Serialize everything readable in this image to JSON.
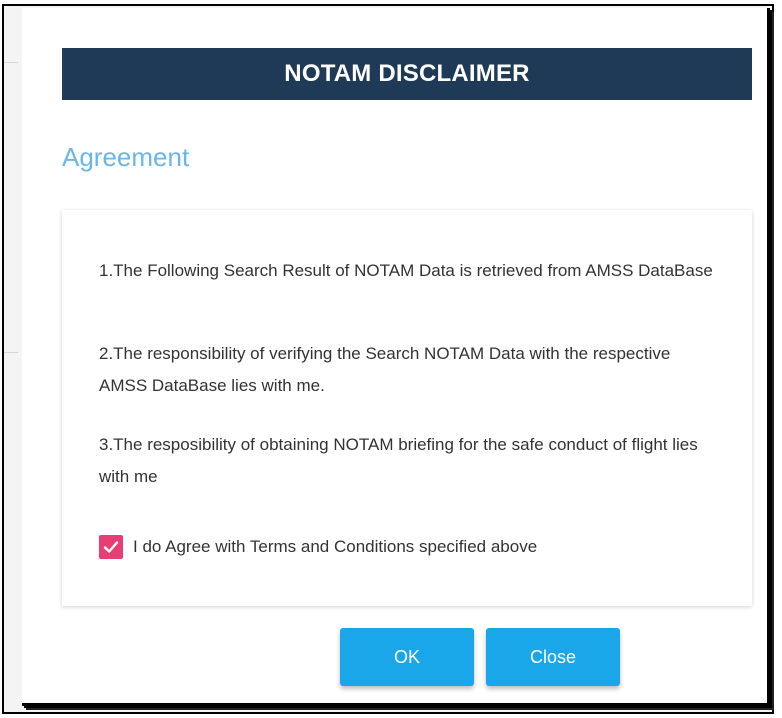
{
  "dialog": {
    "title": "NOTAM DISCLAIMER",
    "section_heading": "Agreement",
    "clauses": [
      "1.The Following Search Result of NOTAM Data is retrieved from AMSS DataBase",
      "2.The responsibility of verifying the Search NOTAM Data with the respective AMSS DataBase lies with me.",
      "3.The resposibility of obtaining NOTAM briefing for the safe conduct of flight lies with me"
    ],
    "agree_checkbox": {
      "checked": true,
      "label": "I do Agree with Terms and Conditions specified above"
    },
    "buttons": {
      "ok_label": "OK",
      "close_label": "Close"
    }
  },
  "colors": {
    "title_bar": "#1f3a56",
    "heading": "#6bb6e8",
    "checkbox": "#e83e73",
    "button": "#1aa7ea"
  },
  "icons": {
    "checkbox_check": "check-icon"
  }
}
